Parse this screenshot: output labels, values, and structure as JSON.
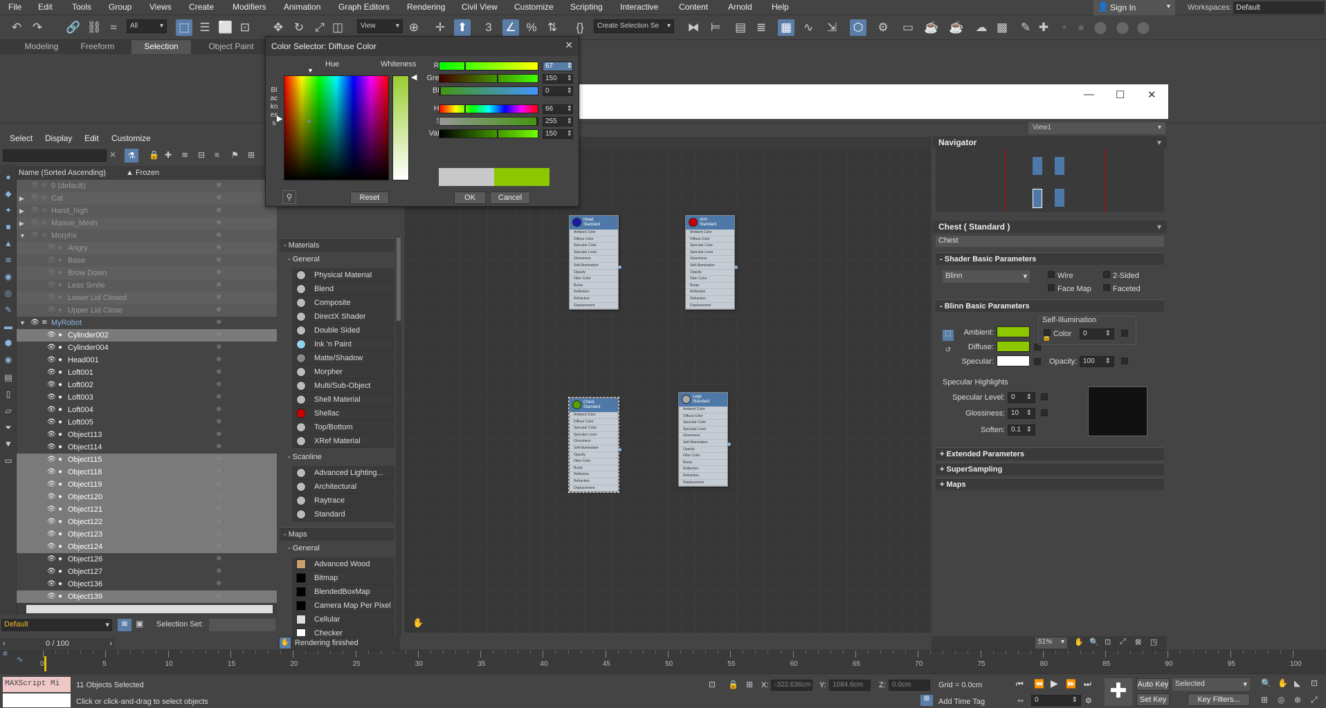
{
  "menubar": [
    "File",
    "Edit",
    "Tools",
    "Group",
    "Views",
    "Create",
    "Modifiers",
    "Animation",
    "Graph Editors",
    "Rendering",
    "Civil View",
    "Customize",
    "Scripting",
    "Interactive",
    "Content",
    "Arnold",
    "Help"
  ],
  "signin": "Sign In",
  "workspaces_label": "Workspaces:",
  "workspaces_value": "Default",
  "toolbar": {
    "filter": "All",
    "view": "View",
    "create_selection": "Create Selection Se"
  },
  "ribbon_tabs": [
    "Modeling",
    "Freeform",
    "Selection",
    "Object Paint"
  ],
  "scene_menu": [
    "Select",
    "Display",
    "Edit",
    "Customize"
  ],
  "explorer": {
    "col_name": "Name (Sorted Ascending)",
    "col_frozen": "▲ Frozen"
  },
  "explorer_rows": [
    {
      "name": "0 (default)",
      "indent": 1,
      "style": "dim"
    },
    {
      "name": "Cat",
      "indent": 1,
      "style": "dim",
      "arrow": "▶"
    },
    {
      "name": "Hand_high",
      "indent": 1,
      "style": "dim",
      "arrow": "▶"
    },
    {
      "name": "Manne_Mesh",
      "indent": 1,
      "style": "dim",
      "arrow": "▶"
    },
    {
      "name": "Morphs",
      "indent": 1,
      "style": "dim",
      "arrow": "▼"
    },
    {
      "name": "Angry",
      "indent": 2,
      "style": "dim"
    },
    {
      "name": "Base",
      "indent": 2,
      "style": "dim"
    },
    {
      "name": "Brow Down",
      "indent": 2,
      "style": "dim"
    },
    {
      "name": "Less Smile",
      "indent": 2,
      "style": "dim"
    },
    {
      "name": "Lower Lid Closed",
      "indent": 2,
      "style": "dim"
    },
    {
      "name": "Upper Lid Close",
      "indent": 2,
      "style": "dim"
    },
    {
      "name": "MyRobot",
      "indent": 1,
      "style": "robot",
      "arrow": "▼"
    },
    {
      "name": "Cylinder002",
      "indent": 2,
      "style": "sel"
    },
    {
      "name": "Cylinder004",
      "indent": 2,
      "style": "norm"
    },
    {
      "name": "Head001",
      "indent": 2,
      "style": "norm"
    },
    {
      "name": "Loft001",
      "indent": 2,
      "style": "norm"
    },
    {
      "name": "Loft002",
      "indent": 2,
      "style": "norm"
    },
    {
      "name": "Loft003",
      "indent": 2,
      "style": "norm"
    },
    {
      "name": "Loft004",
      "indent": 2,
      "style": "norm"
    },
    {
      "name": "Loft005",
      "indent": 2,
      "style": "norm"
    },
    {
      "name": "Object113",
      "indent": 2,
      "style": "norm"
    },
    {
      "name": "Object114",
      "indent": 2,
      "style": "norm"
    },
    {
      "name": "Object115",
      "indent": 2,
      "style": "sel"
    },
    {
      "name": "Object118",
      "indent": 2,
      "style": "sel"
    },
    {
      "name": "Object119",
      "indent": 2,
      "style": "sel"
    },
    {
      "name": "Object120",
      "indent": 2,
      "style": "sel"
    },
    {
      "name": "Object121",
      "indent": 2,
      "style": "sel"
    },
    {
      "name": "Object122",
      "indent": 2,
      "style": "sel"
    },
    {
      "name": "Object123",
      "indent": 2,
      "style": "sel"
    },
    {
      "name": "Object124",
      "indent": 2,
      "style": "sel"
    },
    {
      "name": "Object126",
      "indent": 2,
      "style": "norm"
    },
    {
      "name": "Object127",
      "indent": 2,
      "style": "norm"
    },
    {
      "name": "Object136",
      "indent": 2,
      "style": "norm"
    },
    {
      "name": "Object139",
      "indent": 2,
      "style": "sel"
    }
  ],
  "explorer_bottom": {
    "layer": "Default",
    "selection_set": "Selection Set:"
  },
  "dialog": {
    "title": "Color Selector: Diffuse Color",
    "hue": "Hue",
    "whiteness": "Whiteness",
    "blackness": "Blackness",
    "sliders": [
      {
        "label": "Red:",
        "value": "67",
        "grad": "linear-gradient(to right,#00ff00,#ffff00)",
        "pos": 0.26
      },
      {
        "label": "Green:",
        "value": "150",
        "grad": "linear-gradient(to right,#430000,#43ff00)",
        "pos": 0.59
      },
      {
        "label": "Blue:",
        "value": "0",
        "grad": "linear-gradient(to right,#43960e,#4396ff)",
        "pos": 0.0
      },
      {
        "label": "Hue:",
        "value": "66",
        "grad": "linear-gradient(to right,#f00,#ff0,#0f0,#0ff,#00f,#f0f,#f00)",
        "pos": 0.26
      },
      {
        "label": "Sat:",
        "value": "255",
        "grad": "linear-gradient(to right,#969696,#43960e)",
        "pos": 1.0
      },
      {
        "label": "Value:",
        "value": "150",
        "grad": "linear-gradient(to right,#000,#72ff00)",
        "pos": 0.59
      }
    ],
    "old_color": "#c8c8c8",
    "new_color": "#8cc700",
    "reset": "Reset",
    "ok": "OK",
    "cancel": "Cancel"
  },
  "materials_panel": {
    "materials": "Materials",
    "general": "General",
    "general_items": [
      {
        "name": "Physical Material",
        "c": "#bbb"
      },
      {
        "name": "Blend",
        "c": "#bbb"
      },
      {
        "name": "Composite",
        "c": "#bbb"
      },
      {
        "name": "DirectX Shader",
        "c": "#bbb"
      },
      {
        "name": "Double Sided",
        "c": "#bbb"
      },
      {
        "name": "Ink 'n Paint",
        "c": "#8fd4f0"
      },
      {
        "name": "Matte/Shadow",
        "c": "#888"
      },
      {
        "name": "Morpher",
        "c": "#bbb"
      },
      {
        "name": "Multi/Sub-Object",
        "c": "#bbb"
      },
      {
        "name": "Shell Material",
        "c": "#bbb"
      },
      {
        "name": "Shellac",
        "c": "#cc0000"
      },
      {
        "name": "Top/Bottom",
        "c": "#bbb"
      },
      {
        "name": "XRef Material",
        "c": "#bbb"
      }
    ],
    "scanline": "Scanline",
    "scanline_items": [
      {
        "name": "Advanced Lighting...",
        "c": "#bbb"
      },
      {
        "name": "Architectural",
        "c": "#bbb"
      },
      {
        "name": "Raytrace",
        "c": "#bbb"
      },
      {
        "name": "Standard",
        "c": "#bbb"
      }
    ],
    "maps": "Maps",
    "maps_general": "General",
    "map_items": [
      {
        "name": "Advanced Wood",
        "c": "#c8a070"
      },
      {
        "name": "Bitmap",
        "c": "#000"
      },
      {
        "name": "BlendedBoxMap",
        "c": "#000"
      },
      {
        "name": "Camera Map Per Pixel",
        "c": "#000"
      },
      {
        "name": "Cellular",
        "c": "#ddd"
      },
      {
        "name": "Checker",
        "c": "#fff"
      }
    ]
  },
  "node_slots": [
    "Ambient Color",
    "Diffuse Color",
    "Specular Color",
    "Specular Level",
    "Glossiness",
    "Self-Illumination",
    "Opacity",
    "Filter Color",
    "Bump",
    "Reflection",
    "Refraction",
    "Displacement"
  ],
  "nodes": [
    {
      "name": "Head",
      "type": "Standard",
      "color": "#1a1aaa"
    },
    {
      "name": "Arm",
      "type": "Standard",
      "color": "#cc0000"
    },
    {
      "name": "Chest",
      "type": "Standard",
      "color": "#5aa000"
    },
    {
      "name": "Legs",
      "type": "Standard",
      "color": "#aaaaaa"
    }
  ],
  "view_dropdown": "View1",
  "navigator": "Navigator",
  "rendering_status": "Rendering finished",
  "zoom": "51%",
  "props": {
    "title": "Chest  ( Standard )",
    "name": "Chest",
    "shader_basic": "Shader Basic Parameters",
    "shader": "Blinn",
    "wire": "Wire",
    "two_sided": "2-Sided",
    "face_map": "Face Map",
    "faceted": "Faceted",
    "blinn_basic": "Blinn Basic Parameters",
    "self_illum": "Self-Illumination",
    "ambient": "Ambient:",
    "diffuse": "Diffuse:",
    "specular": "Specular:",
    "ambient_color": "#8cc700",
    "diffuse_color": "#8cc700",
    "specular_color": "#ffffff",
    "color_label": "Color",
    "color_value": "0",
    "opacity_label": "Opacity:",
    "opacity_value": "100",
    "spec_highlights": "Specular Highlights",
    "spec_level": "Specular Level:",
    "spec_level_value": "0",
    "glossiness": "Glossiness:",
    "glossiness_value": "10",
    "soften": "Soften:",
    "soften_value": "0.1",
    "extended": "Extended Parameters",
    "supersampling": "SuperSampling",
    "maps": "Maps"
  },
  "timeline": {
    "frame": "0 / 100",
    "ticks": [
      "0",
      "5",
      "10",
      "15",
      "20",
      "25",
      "30",
      "35",
      "40",
      "45",
      "50",
      "55",
      "60",
      "65",
      "70",
      "75",
      "80",
      "85",
      "90",
      "95",
      "100"
    ]
  },
  "status": {
    "maxscript": "MAXScript Mi",
    "selected": "11 Objects Selected",
    "hint": "Click or click-and-drag to select objects",
    "x_label": "X:",
    "x_value": "-322.636cm",
    "y_label": "Y:",
    "y_value": "1084.6cm",
    "z_label": "Z:",
    "z_value": "0.0cm",
    "grid": "Grid = 0.0cm",
    "add_time_tag": "Add Time Tag",
    "auto_key": "Auto Key",
    "selected_dd": "Selected",
    "set_key": "Set Key",
    "key_filters": "Key Filters...",
    "frame_value": "0"
  }
}
